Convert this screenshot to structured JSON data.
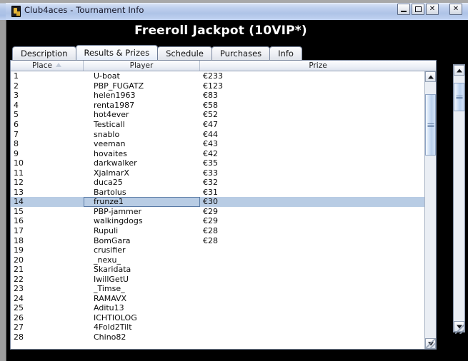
{
  "window": {
    "title": "Club4aces - Tournament Info",
    "icon": "card-app-icon",
    "controls": {
      "minimize": "_",
      "maximize": "□",
      "close": "✕",
      "extra_close": "✕"
    }
  },
  "header": {
    "tournament_title": "Freeroll Jackpot (10VIP*)"
  },
  "tabs": [
    {
      "label": "Description",
      "active": false
    },
    {
      "label": "Results & Prizes",
      "active": true
    },
    {
      "label": "Schedule",
      "active": false
    },
    {
      "label": "Purchases",
      "active": false
    },
    {
      "label": "Info",
      "active": false
    }
  ],
  "table": {
    "columns": [
      {
        "label": "Place",
        "sorted": "ascending",
        "sort_icon": "sort-ascending-triangle"
      },
      {
        "label": "Player",
        "sorted": "none"
      },
      {
        "label": "Prize",
        "sorted": "none"
      }
    ],
    "selected_place": "14",
    "rows": [
      {
        "place": "1",
        "player": "U-boat",
        "prize": "€233"
      },
      {
        "place": "2",
        "player": "PBP_FUGATZ",
        "prize": "€123"
      },
      {
        "place": "3",
        "player": "helen1963",
        "prize": "€83"
      },
      {
        "place": "4",
        "player": "renta1987",
        "prize": "€58"
      },
      {
        "place": "5",
        "player": "hot4ever",
        "prize": "€52"
      },
      {
        "place": "6",
        "player": "Testicall",
        "prize": "€47"
      },
      {
        "place": "7",
        "player": "snablo",
        "prize": "€44"
      },
      {
        "place": "8",
        "player": "veeman",
        "prize": "€43"
      },
      {
        "place": "9",
        "player": "hovaites",
        "prize": "€42"
      },
      {
        "place": "10",
        "player": "darkwalker",
        "prize": "€35"
      },
      {
        "place": "11",
        "player": "XjalmarX",
        "prize": "€33"
      },
      {
        "place": "12",
        "player": "duca25",
        "prize": "€32"
      },
      {
        "place": "13",
        "player": "Bartolus",
        "prize": "€31"
      },
      {
        "place": "14",
        "player": "frunze1",
        "prize": "€30"
      },
      {
        "place": "15",
        "player": "PBP-jammer",
        "prize": "€29"
      },
      {
        "place": "16",
        "player": "walkingdogs",
        "prize": "€29"
      },
      {
        "place": "17",
        "player": "Rupuli",
        "prize": "€28"
      },
      {
        "place": "18",
        "player": "BomGara",
        "prize": "€28"
      },
      {
        "place": "19",
        "player": "crusifier",
        "prize": ""
      },
      {
        "place": "20",
        "player": "_nexu_",
        "prize": ""
      },
      {
        "place": "21",
        "player": "Skaridata",
        "prize": ""
      },
      {
        "place": "22",
        "player": "IwillGetU",
        "prize": ""
      },
      {
        "place": "23",
        "player": "_Timse_",
        "prize": ""
      },
      {
        "place": "24",
        "player": "RAMAVX",
        "prize": ""
      },
      {
        "place": "25",
        "player": "Aditu13",
        "prize": ""
      },
      {
        "place": "26",
        "player": "ICHTIOLOG",
        "prize": ""
      },
      {
        "place": "27",
        "player": "4Fold2Tilt",
        "prize": ""
      },
      {
        "place": "28",
        "player": "Chino82",
        "prize": ""
      }
    ]
  },
  "scrollbars": {
    "table": {
      "up_icon": "scroll-up-arrow",
      "down_icon": "scroll-down-arrow",
      "thumb": "scroll-thumb"
    },
    "window": {
      "up_icon": "scroll-up-arrow",
      "down_icon": "scroll-down-arrow",
      "thumb": "scroll-thumb"
    }
  },
  "colors": {
    "titlebar": "#b2c6e8",
    "canvas": "#000000",
    "selection": "#b8cce4",
    "header_text": "#ffffff"
  }
}
